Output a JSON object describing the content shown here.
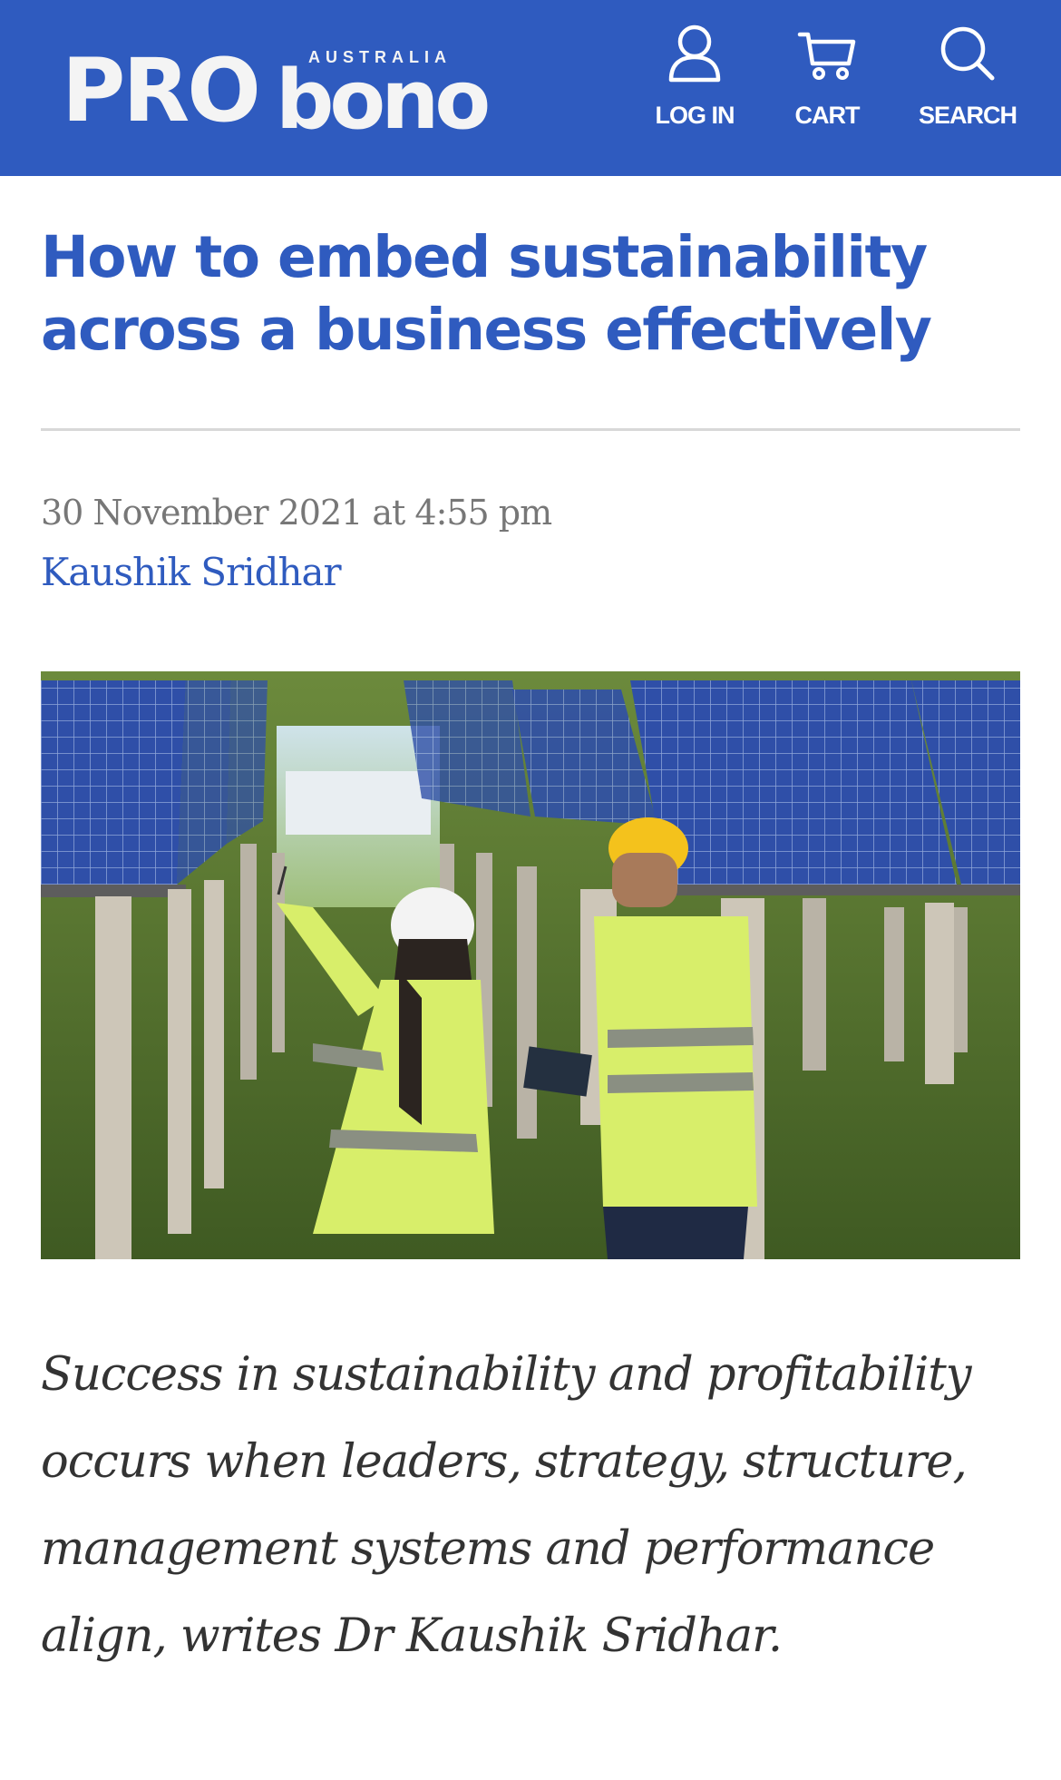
{
  "header": {
    "logo": {
      "pro": "PRO",
      "bono": "bono",
      "country": "AUSTRALIA"
    },
    "nav": {
      "login": {
        "label": "LOG IN",
        "icon": "user-icon"
      },
      "cart": {
        "label": "CART",
        "icon": "cart-icon"
      },
      "search": {
        "label": "SEARCH",
        "icon": "search-icon"
      }
    }
  },
  "article": {
    "title": "How to embed sustainability across a business effectively",
    "date": "30 November 2021 at 4:55 pm",
    "author": "Kaushik Sridhar",
    "lede": "Success in sustainability and profitability occurs when leaders, strategy, structure, management systems and performance align, writes Dr Kaushik Sridhar."
  },
  "colors": {
    "brand_blue": "#2f5bbf",
    "meta_grey": "#777777",
    "body_text": "#333333",
    "divider": "#d8d8d8"
  }
}
